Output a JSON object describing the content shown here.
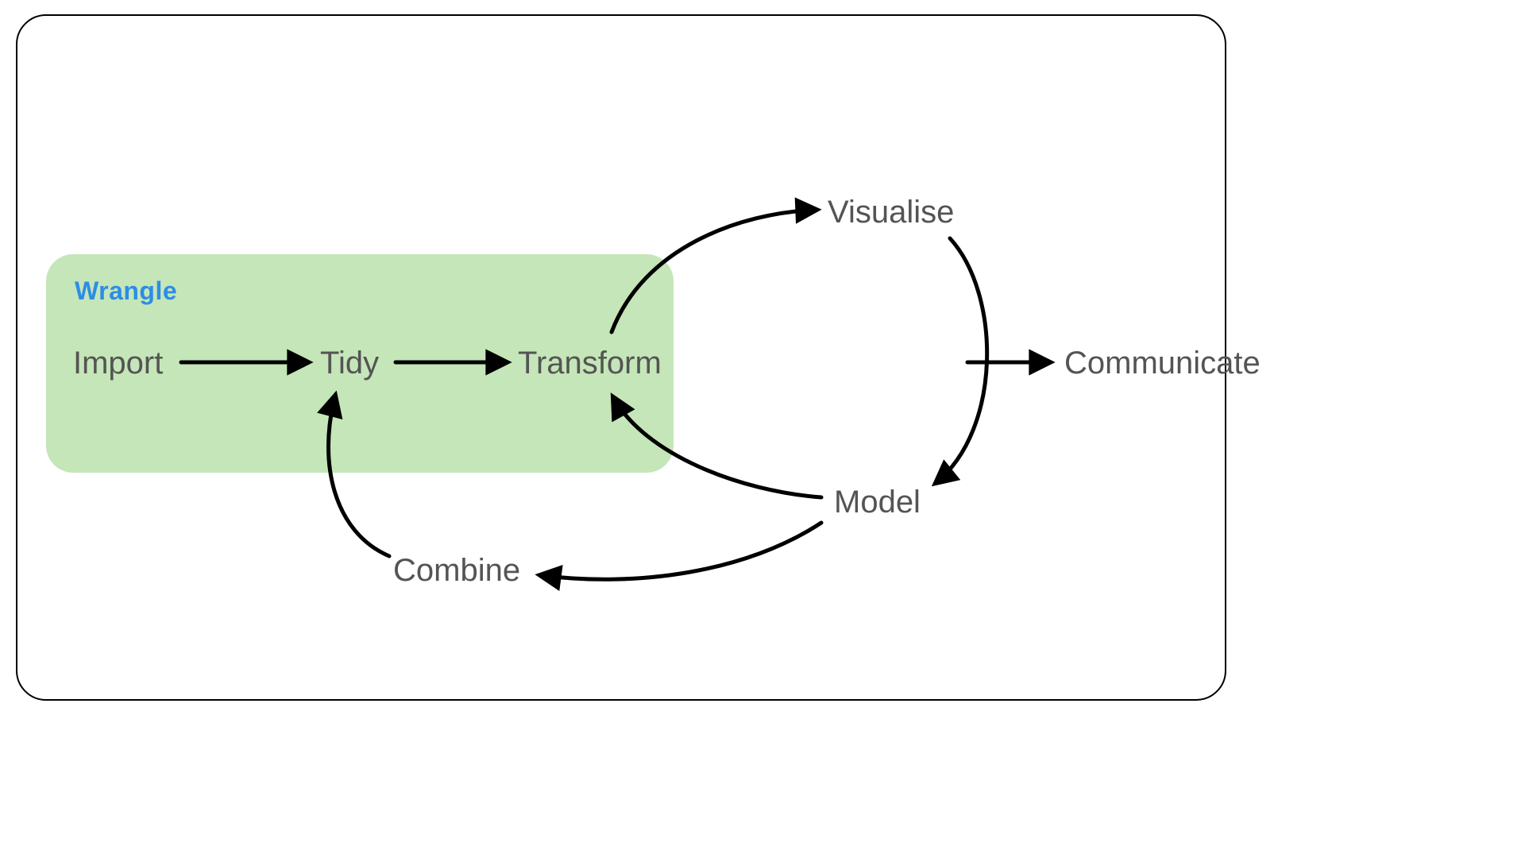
{
  "diagram": {
    "group_label": "Wrangle",
    "nodes": {
      "import": "Import",
      "tidy": "Tidy",
      "transform": "Transform",
      "visualise": "Visualise",
      "model": "Model",
      "combine": "Combine",
      "communicate": "Communicate"
    },
    "edges": [
      {
        "from": "import",
        "to": "tidy",
        "kind": "straight"
      },
      {
        "from": "tidy",
        "to": "transform",
        "kind": "straight"
      },
      {
        "from": "transform",
        "to": "visualise",
        "kind": "curve"
      },
      {
        "from": "visualise",
        "to": "model",
        "kind": "curve"
      },
      {
        "from": "model",
        "to": "transform",
        "kind": "curve"
      },
      {
        "from": "model",
        "to": "combine",
        "kind": "curve"
      },
      {
        "from": "combine",
        "to": "tidy",
        "kind": "curve"
      },
      {
        "from": "cycle",
        "to": "communicate",
        "kind": "straight"
      }
    ],
    "highlight_group": [
      "import",
      "tidy",
      "transform"
    ]
  }
}
